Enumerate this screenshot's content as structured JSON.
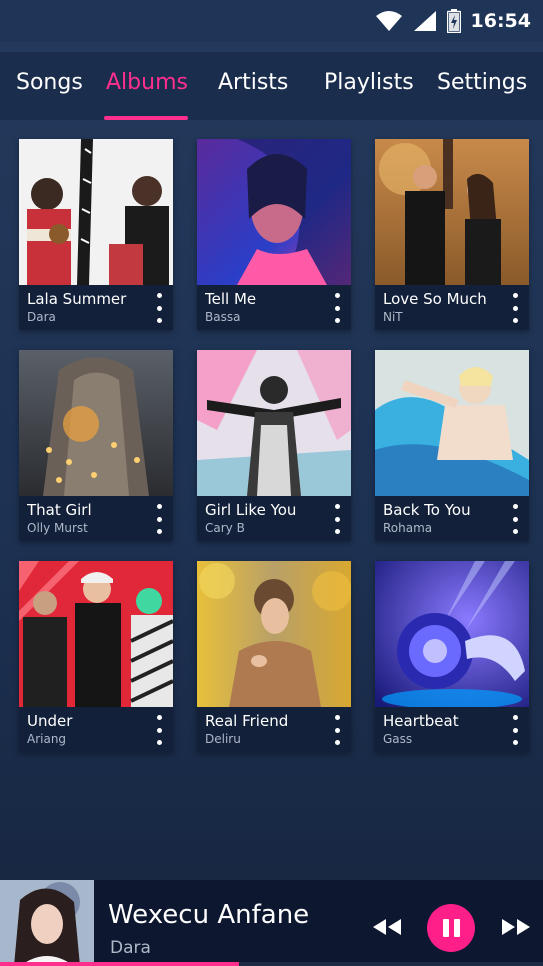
{
  "status_bar": {
    "time": "16:54",
    "icons": [
      "wifi-icon",
      "cell-signal-icon",
      "battery-charging-icon"
    ]
  },
  "tabs": [
    {
      "label": "Songs",
      "active": false
    },
    {
      "label": "Albums",
      "active": true
    },
    {
      "label": "Artists",
      "active": false
    },
    {
      "label": "Playlists",
      "active": false
    },
    {
      "label": "Settings",
      "active": false
    }
  ],
  "albums": [
    {
      "title": "Lala Summer",
      "artist": "Dara"
    },
    {
      "title": "Tell Me",
      "artist": "Bassa"
    },
    {
      "title": "Love So Much",
      "artist": "NiT"
    },
    {
      "title": "That Girl",
      "artist": "Olly Murst"
    },
    {
      "title": "Girl Like You",
      "artist": "Cary B"
    },
    {
      "title": "Back To You",
      "artist": "Rohama"
    },
    {
      "title": "Under",
      "artist": "Ariang"
    },
    {
      "title": "Real Friend",
      "artist": "Deliru"
    },
    {
      "title": "Heartbeat",
      "artist": "Gass"
    }
  ],
  "player": {
    "song": "Wexecu Anfane",
    "artist": "Dara",
    "progress": 0.44,
    "icons": [
      "rewind-icon",
      "pause-icon",
      "fast-forward-icon"
    ]
  },
  "colors": {
    "accent": "#ff2f8e",
    "background": "#213759",
    "tab_bar": "#1a2d4d",
    "card_meta": "#12203a"
  }
}
